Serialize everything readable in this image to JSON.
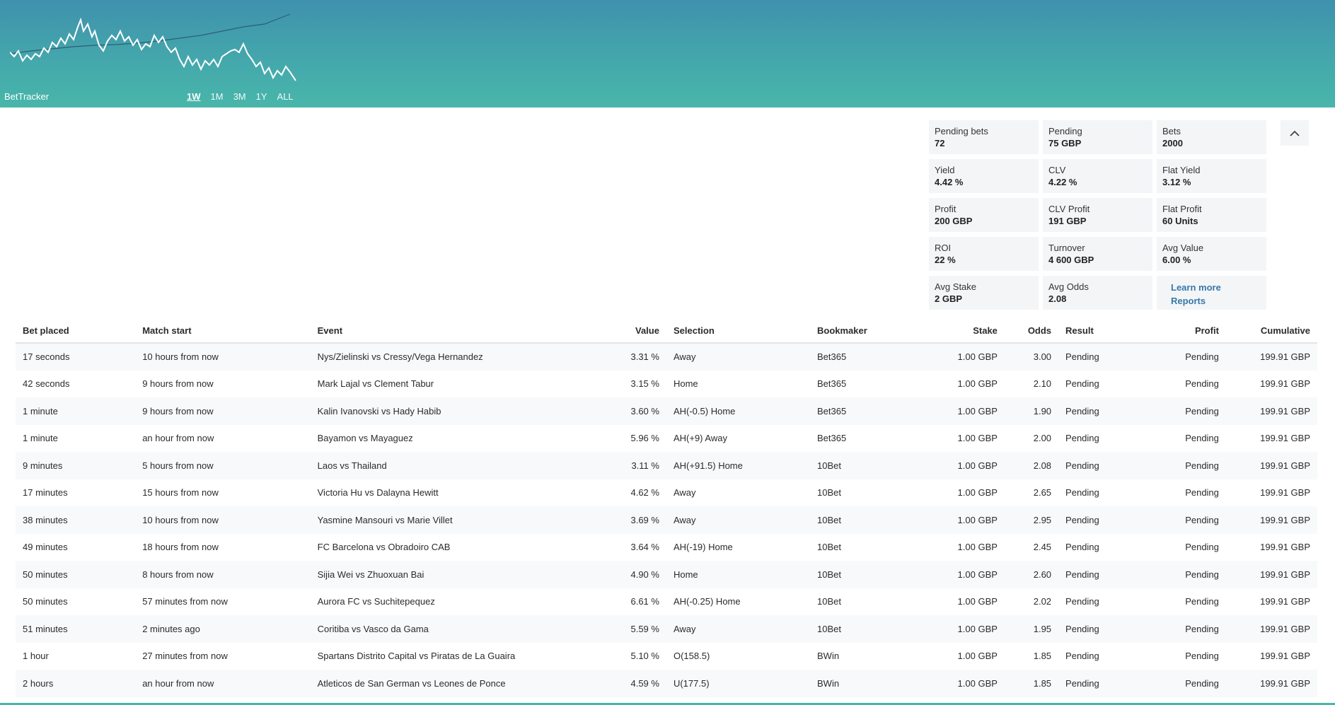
{
  "header": {
    "brand": "BetTracker",
    "ranges": [
      "1W",
      "1M",
      "3M",
      "1Y",
      "ALL"
    ],
    "active_range": "1W"
  },
  "stats": [
    {
      "label": "Pending bets",
      "value": "72"
    },
    {
      "label": "Pending",
      "value": "75 GBP"
    },
    {
      "label": "Bets",
      "value": "2000"
    },
    {
      "label": "Yield",
      "value": "4.42 %"
    },
    {
      "label": "CLV",
      "value": "4.22 %"
    },
    {
      "label": "Flat Yield",
      "value": "3.12 %"
    },
    {
      "label": "Profit",
      "value": "200 GBP"
    },
    {
      "label": "CLV Profit",
      "value": "191 GBP"
    },
    {
      "label": "Flat Profit",
      "value": "60 Units"
    },
    {
      "label": "ROI",
      "value": "22 %"
    },
    {
      "label": "Turnover",
      "value": "4 600 GBP"
    },
    {
      "label": "Avg Value",
      "value": "6.00 %"
    },
    {
      "label": "Avg Stake",
      "value": "2 GBP"
    },
    {
      "label": "Avg Odds",
      "value": "2.08"
    }
  ],
  "links": {
    "learn_more": "Learn more",
    "reports": "Reports"
  },
  "table": {
    "headers": [
      "Bet placed",
      "Match start",
      "Event",
      "Value",
      "Selection",
      "Bookmaker",
      "Stake",
      "Odds",
      "Result",
      "Profit",
      "Cumulative"
    ],
    "rows": [
      [
        "17 seconds",
        "10 hours from now",
        "Nys/Zielinski vs Cressy/Vega Hernandez",
        "3.31 %",
        "Away",
        "Bet365",
        "1.00 GBP",
        "3.00",
        "Pending",
        "Pending",
        "199.91 GBP"
      ],
      [
        "42 seconds",
        "9 hours from now",
        "Mark Lajal vs Clement Tabur",
        "3.15 %",
        "Home",
        "Bet365",
        "1.00 GBP",
        "2.10",
        "Pending",
        "Pending",
        "199.91 GBP"
      ],
      [
        "1 minute",
        "9 hours from now",
        "Kalin Ivanovski vs Hady Habib",
        "3.60 %",
        "AH(-0.5) Home",
        "Bet365",
        "1.00 GBP",
        "1.90",
        "Pending",
        "Pending",
        "199.91 GBP"
      ],
      [
        "1 minute",
        "an hour from now",
        "Bayamon vs Mayaguez",
        "5.96 %",
        "AH(+9) Away",
        "Bet365",
        "1.00 GBP",
        "2.00",
        "Pending",
        "Pending",
        "199.91 GBP"
      ],
      [
        "9 minutes",
        "5 hours from now",
        "Laos vs Thailand",
        "3.11 %",
        "AH(+91.5) Home",
        "10Bet",
        "1.00 GBP",
        "2.08",
        "Pending",
        "Pending",
        "199.91 GBP"
      ],
      [
        "17 minutes",
        "15 hours from now",
        "Victoria Hu vs Dalayna Hewitt",
        "4.62 %",
        "Away",
        "10Bet",
        "1.00 GBP",
        "2.65",
        "Pending",
        "Pending",
        "199.91 GBP"
      ],
      [
        "38 minutes",
        "10 hours from now",
        "Yasmine Mansouri vs Marie Villet",
        "3.69 %",
        "Away",
        "10Bet",
        "1.00 GBP",
        "2.95",
        "Pending",
        "Pending",
        "199.91 GBP"
      ],
      [
        "49 minutes",
        "18 hours from now",
        "FC Barcelona vs Obradoiro CAB",
        "3.64 %",
        "AH(-19) Home",
        "10Bet",
        "1.00 GBP",
        "2.45",
        "Pending",
        "Pending",
        "199.91 GBP"
      ],
      [
        "50 minutes",
        "8 hours from now",
        "Sijia Wei vs Zhuoxuan Bai",
        "4.90 %",
        "Home",
        "10Bet",
        "1.00 GBP",
        "2.60",
        "Pending",
        "Pending",
        "199.91 GBP"
      ],
      [
        "50 minutes",
        "57 minutes from now",
        "Aurora FC vs Suchitepequez",
        "6.61 %",
        "AH(-0.25) Home",
        "10Bet",
        "1.00 GBP",
        "2.02",
        "Pending",
        "Pending",
        "199.91 GBP"
      ],
      [
        "51 minutes",
        "2 minutes ago",
        "Coritiba vs Vasco da Gama",
        "5.59 %",
        "Away",
        "10Bet",
        "1.00 GBP",
        "1.95",
        "Pending",
        "Pending",
        "199.91 GBP"
      ],
      [
        "1 hour",
        "27 minutes from now",
        "Spartans Distrito Capital vs Piratas de La Guaira",
        "5.10 %",
        "O(158.5)",
        "BWin",
        "1.00 GBP",
        "1.85",
        "Pending",
        "Pending",
        "199.91 GBP"
      ],
      [
        "2 hours",
        "an hour from now",
        "Atleticos de San German vs Leones de Ponce",
        "4.59 %",
        "U(177.5)",
        "BWin",
        "1.00 GBP",
        "1.85",
        "Pending",
        "Pending",
        "199.91 GBP"
      ]
    ]
  },
  "colors": {
    "header_top": "#3f91ad",
    "header_bottom": "#48b6aa",
    "pending": "#f2a93b",
    "past": "#d94a3a",
    "link": "#3778a8"
  }
}
